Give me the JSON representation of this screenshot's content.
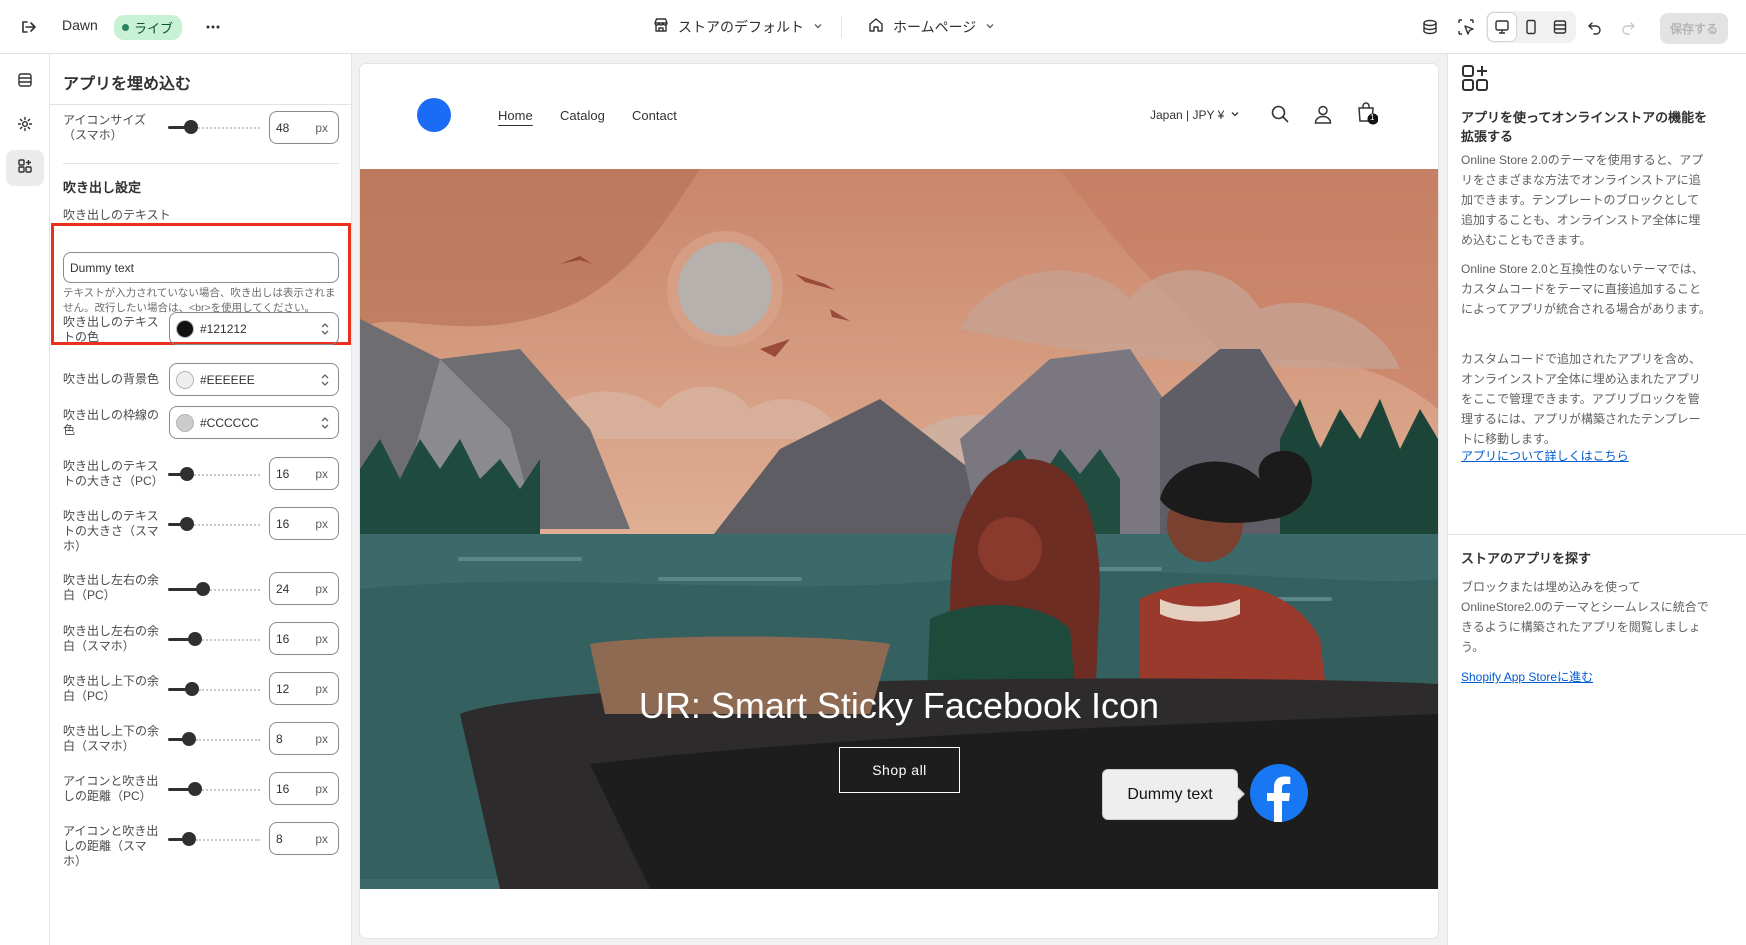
{
  "topbar": {
    "theme_name": "Dawn",
    "live_badge": "ライブ",
    "store_select": "ストアのデフォルト",
    "page_select": "ホームページ",
    "save_label": "保存する"
  },
  "panel": {
    "title": "アプリを埋め込む",
    "icon_size_mobile": {
      "label": "アイコンサイズ（スマホ）",
      "value": "48",
      "unit": "px",
      "fraction": 0.2
    },
    "bubble_section_title": "吹き出し設定",
    "bubble_text": {
      "label": "吹き出しのテキスト",
      "value": "Dummy text",
      "help": "テキストが入力されていない場合、吹き出しは表示されません。改行したい場合は、<br>を使用してください。"
    },
    "text_color": {
      "label": "吹き出しのテキストの色",
      "value": "#121212",
      "swatch": "#121212"
    },
    "bg_color": {
      "label": "吹き出しの背景色",
      "value": "#EEEEEE",
      "swatch": "#eeeeee"
    },
    "border_color": {
      "label": "吹き出しの枠線の色",
      "value": "#CCCCCC",
      "swatch": "#cccccc"
    },
    "text_size_pc": {
      "label": "吹き出しのテキストの大きさ（PC）",
      "value": "16",
      "unit": "px",
      "fraction": 0.16
    },
    "text_size_mobile": {
      "label": "吹き出しのテキストの大きさ（スマホ）",
      "value": "16",
      "unit": "px",
      "fraction": 0.16
    },
    "padding_x_pc": {
      "label": "吹き出し左右の余白（PC）",
      "value": "24",
      "unit": "px",
      "fraction": 0.36
    },
    "padding_x_mobile": {
      "label": "吹き出し左右の余白（スマホ）",
      "value": "16",
      "unit": "px",
      "fraction": 0.26
    },
    "padding_y_pc": {
      "label": "吹き出し上下の余白（PC）",
      "value": "12",
      "unit": "px",
      "fraction": 0.22
    },
    "padding_y_mobile": {
      "label": "吹き出し上下の余白（スマホ）",
      "value": "8",
      "unit": "px",
      "fraction": 0.18
    },
    "gap_pc": {
      "label": "アイコンと吹き出しの距離（PC）",
      "value": "16",
      "unit": "px",
      "fraction": 0.26
    },
    "gap_mobile": {
      "label": "アイコンと吹き出しの距離（スマホ）",
      "value": "8",
      "unit": "px",
      "fraction": 0.18
    }
  },
  "preview": {
    "nav": [
      "Home",
      "Catalog",
      "Contact"
    ],
    "locale": "Japan | JPY ¥",
    "cart_count": "1",
    "hero_title": "UR: Smart Sticky Facebook Icon",
    "hero_button": "Shop all",
    "bubble_text": "Dummy text",
    "fb_color": "#1877f2"
  },
  "info": {
    "heading1": "アプリを使ってオンラインストアの機能を拡張する",
    "para1": "Online Store 2.0のテーマを使用すると、アプリをさまざまな方法でオンラインストアに追加できます。テンプレートのブロックとして追加することも、オンラインストア全体に埋め込むこともできます。",
    "para2": "Online Store 2.0と互換性のないテーマでは、カスタムコードをテーマに直接追加することによってアプリが統合される場合があります。",
    "para3": "カスタムコードで追加されたアプリを含め、オンラインストア全体に埋め込まれたアプリをここで管理できます。アプリブロックを管理するには、アプリが構築されたテンプレートに移動します。",
    "link1": "アプリについて詳しくはこちら",
    "heading2": "ストアのアプリを探す",
    "para4": "ブロックまたは埋め込みを使ってOnlineStore2.0のテーマとシームレスに統合できるように構築されたアプリを閲覧しましょう。",
    "link2": "Shopify App Storeに進む"
  },
  "colors": {
    "accent": "#1a6bf5",
    "highlight": "#e8321e"
  }
}
